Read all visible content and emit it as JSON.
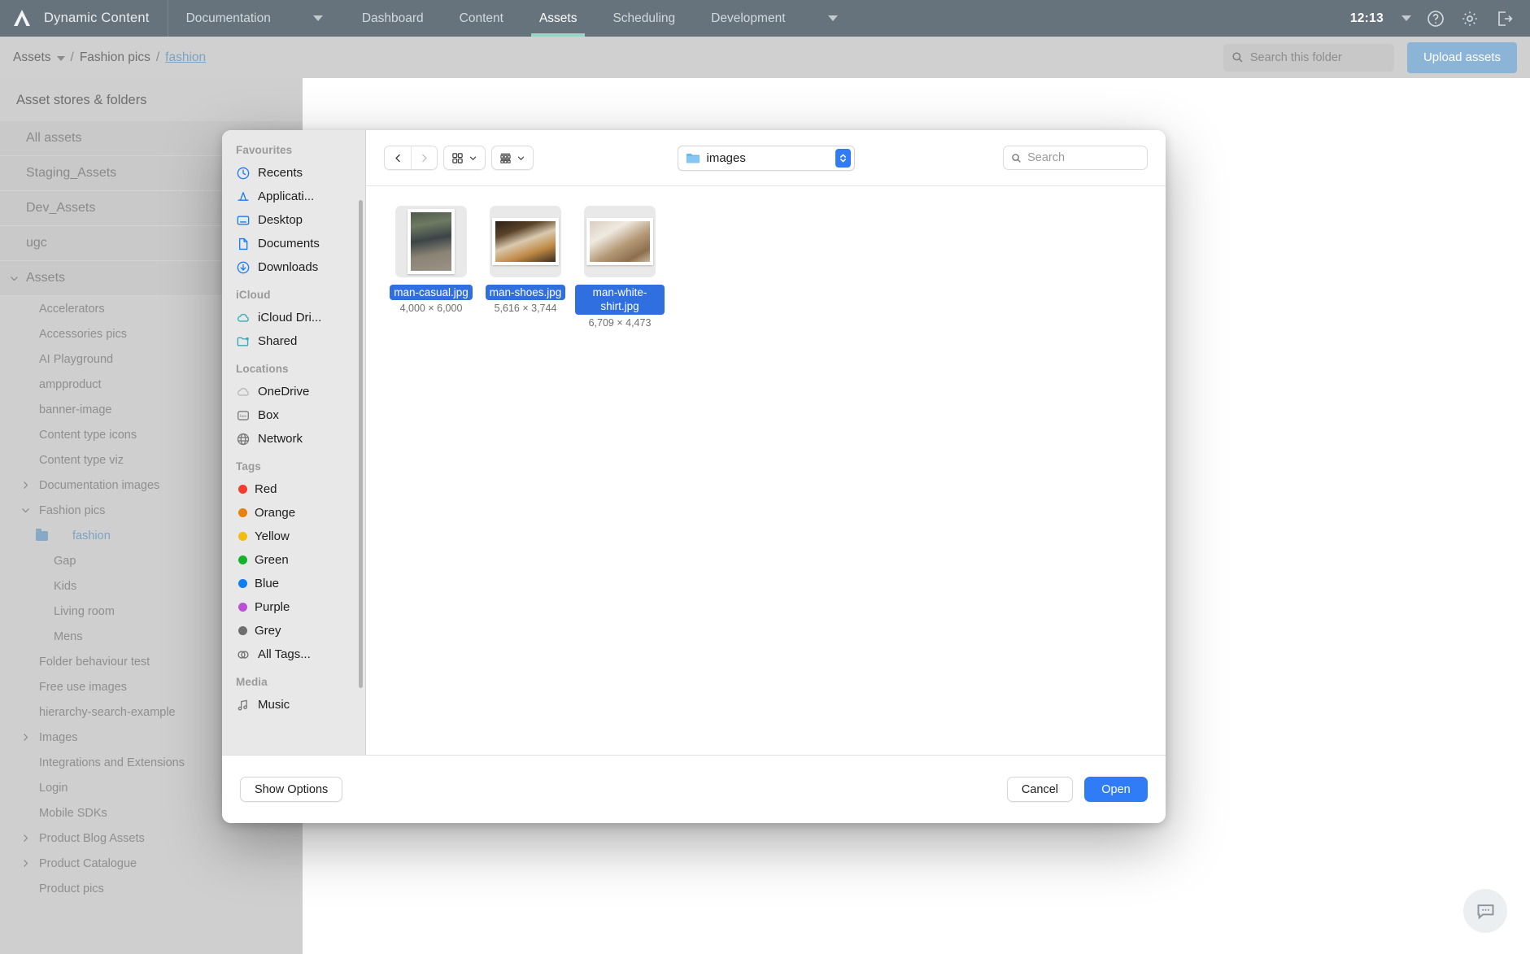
{
  "app": {
    "brand": "Dynamic Content",
    "nav": [
      {
        "label": "Documentation",
        "has_caret": true,
        "active": false
      },
      {
        "label": "Dashboard",
        "has_caret": false,
        "active": false
      },
      {
        "label": "Content",
        "has_caret": false,
        "active": false
      },
      {
        "label": "Assets",
        "has_caret": false,
        "active": true
      },
      {
        "label": "Scheduling",
        "has_caret": false,
        "active": false
      },
      {
        "label": "Development",
        "has_caret": true,
        "active": false
      }
    ],
    "clock": "12:13",
    "top_icons": [
      "help-icon",
      "settings-icon",
      "logout-icon"
    ]
  },
  "breadcrumb": {
    "root": "Assets",
    "separator": "/",
    "parent": "Fashion pics",
    "current": "fashion",
    "search_placeholder": "Search this folder",
    "search_value": "",
    "upload_label": "Upload assets"
  },
  "sidebar": {
    "title": "Asset stores & folders",
    "stores": [
      {
        "label": "All assets",
        "twisty": "none"
      },
      {
        "label": "Staging_Assets",
        "twisty": "none"
      },
      {
        "label": "Dev_Assets",
        "twisty": "none"
      },
      {
        "label": "ugc",
        "twisty": "none"
      },
      {
        "label": "Assets",
        "twisty": "expanded"
      }
    ],
    "folders": [
      {
        "label": "Accelerators",
        "twisty": "none",
        "level": 1,
        "selected": false
      },
      {
        "label": "Accessories pics",
        "twisty": "none",
        "level": 1,
        "selected": false
      },
      {
        "label": "AI Playground",
        "twisty": "none",
        "level": 1,
        "selected": false
      },
      {
        "label": "ampproduct",
        "twisty": "none",
        "level": 1,
        "selected": false
      },
      {
        "label": "banner-image",
        "twisty": "none",
        "level": 1,
        "selected": false
      },
      {
        "label": "Content type icons",
        "twisty": "none",
        "level": 1,
        "selected": false
      },
      {
        "label": "Content type viz",
        "twisty": "none",
        "level": 1,
        "selected": false
      },
      {
        "label": "Documentation images",
        "twisty": "collapsed",
        "level": 1,
        "selected": false
      },
      {
        "label": "Fashion pics",
        "twisty": "expanded",
        "level": 1,
        "selected": false
      },
      {
        "label": "fashion",
        "twisty": "none",
        "level": 2,
        "selected": true
      },
      {
        "label": "Gap",
        "twisty": "none",
        "level": 2,
        "selected": false
      },
      {
        "label": "Kids",
        "twisty": "none",
        "level": 2,
        "selected": false
      },
      {
        "label": "Living room",
        "twisty": "none",
        "level": 2,
        "selected": false
      },
      {
        "label": "Mens",
        "twisty": "none",
        "level": 2,
        "selected": false
      },
      {
        "label": "Folder behaviour test",
        "twisty": "none",
        "level": 1,
        "selected": false
      },
      {
        "label": "Free use images",
        "twisty": "none",
        "level": 1,
        "selected": false
      },
      {
        "label": "hierarchy-search-example",
        "twisty": "none",
        "level": 1,
        "selected": false
      },
      {
        "label": "Images",
        "twisty": "collapsed",
        "level": 1,
        "selected": false
      },
      {
        "label": "Integrations and Extensions",
        "twisty": "none",
        "level": 1,
        "selected": false
      },
      {
        "label": "Login",
        "twisty": "none",
        "level": 1,
        "selected": false
      },
      {
        "label": "Mobile SDKs",
        "twisty": "none",
        "level": 1,
        "selected": false
      },
      {
        "label": "Product Blog Assets",
        "twisty": "collapsed",
        "level": 1,
        "selected": false
      },
      {
        "label": "Product Catalogue",
        "twisty": "collapsed",
        "level": 1,
        "selected": false
      },
      {
        "label": "Product pics",
        "twisty": "none",
        "level": 1,
        "selected": false
      }
    ]
  },
  "dialog": {
    "sidebar_sections": [
      {
        "header": "Favourites",
        "items": [
          {
            "label": "Recents",
            "icon": "clock-icon",
            "color": "#1c7cf2"
          },
          {
            "label": "Applicati...",
            "icon": "applications-icon",
            "color": "#1c7cf2"
          },
          {
            "label": "Desktop",
            "icon": "desktop-icon",
            "color": "#1c7cf2"
          },
          {
            "label": "Documents",
            "icon": "document-icon",
            "color": "#1c7cf2"
          },
          {
            "label": "Downloads",
            "icon": "download-icon",
            "color": "#1c7cf2"
          }
        ]
      },
      {
        "header": "iCloud",
        "items": [
          {
            "label": "iCloud Dri...",
            "icon": "cloud-icon",
            "color": "#3aa8b8"
          },
          {
            "label": "Shared",
            "icon": "shared-folder-icon",
            "color": "#3aa8b8"
          }
        ]
      },
      {
        "header": "Locations",
        "items": [
          {
            "label": "OneDrive",
            "icon": "onedrive-cloud-icon",
            "color": "#b8b8b8"
          },
          {
            "label": "Box",
            "icon": "box-icon",
            "color": "#7a7a7a"
          },
          {
            "label": "Network",
            "icon": "globe-icon",
            "color": "#7a7a7a"
          }
        ]
      },
      {
        "header": "Tags",
        "items": [
          {
            "label": "Red",
            "icon": "tag-dot-icon",
            "color": "#f23c2e"
          },
          {
            "label": "Orange",
            "icon": "tag-dot-icon",
            "color": "#e8820c"
          },
          {
            "label": "Yellow",
            "icon": "tag-dot-icon",
            "color": "#f0bc11"
          },
          {
            "label": "Green",
            "icon": "tag-dot-icon",
            "color": "#12b22b"
          },
          {
            "label": "Blue",
            "icon": "tag-dot-icon",
            "color": "#0b7ff0"
          },
          {
            "label": "Purple",
            "icon": "tag-dot-icon",
            "color": "#bb4ed6"
          },
          {
            "label": "Grey",
            "icon": "tag-dot-icon",
            "color": "#6e6e6e"
          },
          {
            "label": "All Tags...",
            "icon": "all-tags-icon",
            "color": "#6e6e6e"
          }
        ]
      },
      {
        "header": "Media",
        "items": [
          {
            "label": "Music",
            "icon": "music-note-icon",
            "color": "#7a7a7a"
          }
        ]
      }
    ],
    "toolbar": {
      "back_icon": "chevron-left-icon",
      "forward_icon": "chevron-right-icon",
      "view_mode_icon": "icon-view-icon",
      "group_by_icon": "group-view-icon",
      "path_label": "images",
      "search_placeholder": "Search",
      "search_value": ""
    },
    "files": [
      {
        "name": "man-casual.jpg",
        "dimensions": "4,000 × 6,000",
        "orientation": "portrait",
        "selected": true
      },
      {
        "name": "man-shoes.jpg",
        "dimensions": "5,616 × 3,744",
        "orientation": "landscape",
        "selected": true
      },
      {
        "name": "man-white-shirt.jpg",
        "dimensions": "6,709 × 4,473",
        "orientation": "landscape",
        "selected": true
      }
    ],
    "footer": {
      "show_options_label": "Show Options",
      "cancel_label": "Cancel",
      "open_label": "Open"
    }
  },
  "colors": {
    "topbar": "#66737d",
    "accent_teal": "#95d6c4",
    "mac_blue": "#2f7cf6",
    "selection_blue": "#2f6fe0",
    "upload_button": "#8cb4d6"
  }
}
